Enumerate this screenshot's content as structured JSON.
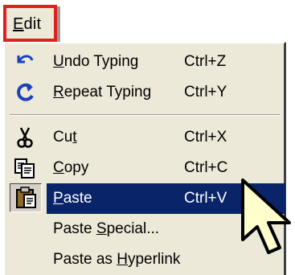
{
  "menu": {
    "title": "Edit",
    "title_hotkey": "E",
    "title_rest": "dit",
    "highlight_color": "#e0201c"
  },
  "items": [
    {
      "label": "Undo Typing",
      "shortcut": "Ctrl+Z",
      "icon": "undo-icon"
    },
    {
      "label": "Repeat Typing",
      "shortcut": "Ctrl+Y",
      "icon": "redo-icon"
    },
    {
      "label": "Cut",
      "shortcut": "Ctrl+X",
      "icon": "scissors-icon"
    },
    {
      "label": "Copy",
      "shortcut": "Ctrl+C",
      "icon": "copy-icon"
    },
    {
      "label": "Paste",
      "shortcut": "Ctrl+V",
      "icon": "paste-icon",
      "selected": true
    },
    {
      "label": "Paste Special...",
      "shortcut": ""
    },
    {
      "label": "Paste as Hyperlink",
      "shortcut": ""
    }
  ],
  "colors": {
    "menu_bg": "#ece9d8",
    "selection_bg": "#0a246a",
    "selection_text": "#ffffff"
  }
}
